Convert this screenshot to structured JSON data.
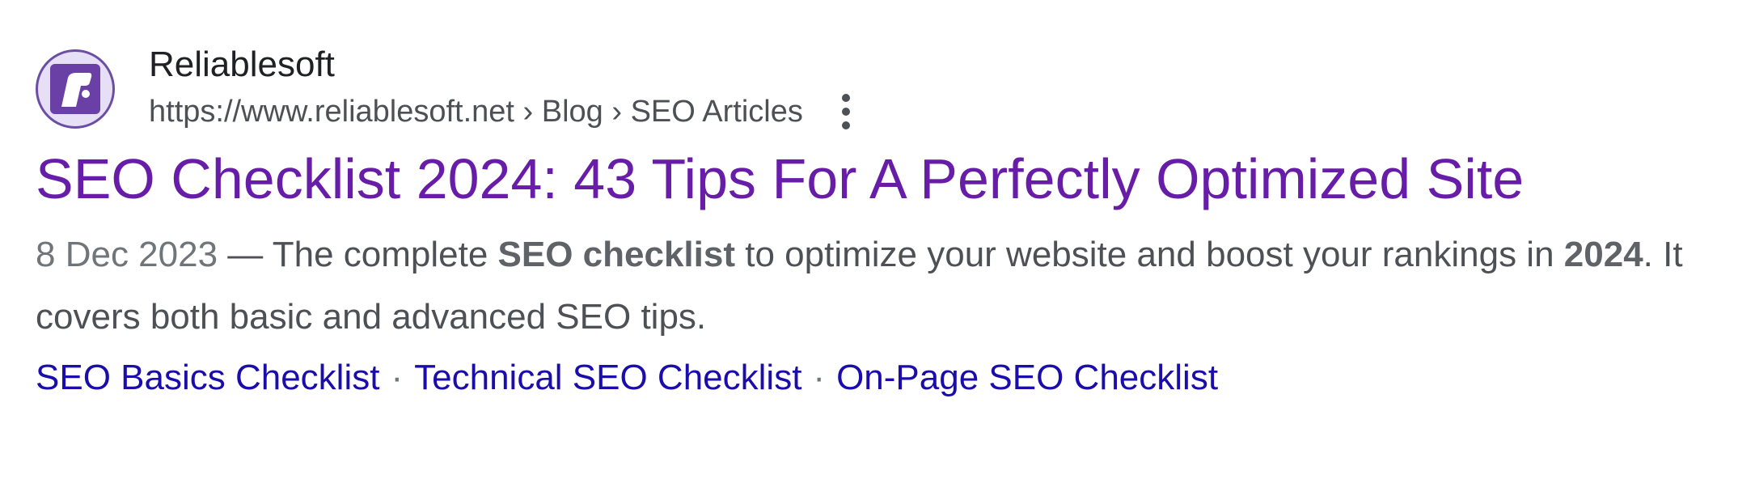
{
  "result": {
    "site_name": "Reliablesoft",
    "breadcrumb": "https://www.reliablesoft.net › Blog › SEO Articles",
    "favicon_icon": "reliablesoft-r-logo",
    "more_icon": "three-dots-vertical-icon",
    "title": "SEO Checklist 2024: 43 Tips For A Perfectly Optimized Site",
    "snippet": {
      "date": "8 Dec 2023",
      "dash": " — ",
      "text_before": "The complete ",
      "bold_1": "SEO checklist",
      "text_middle": " to optimize your website and boost your rankings in ",
      "bold_2": "2024",
      "text_after": ". It covers both basic and advanced SEO tips."
    },
    "sitelinks": [
      "SEO Basics Checklist",
      "Technical SEO Checklist",
      "On-Page SEO Checklist"
    ],
    "sitelink_separator": "·"
  },
  "colors": {
    "title_visited": "#681da8",
    "sitelink": "#1a0dab",
    "body_text": "#4d5156",
    "favicon_purple": "#6a3fa6"
  }
}
